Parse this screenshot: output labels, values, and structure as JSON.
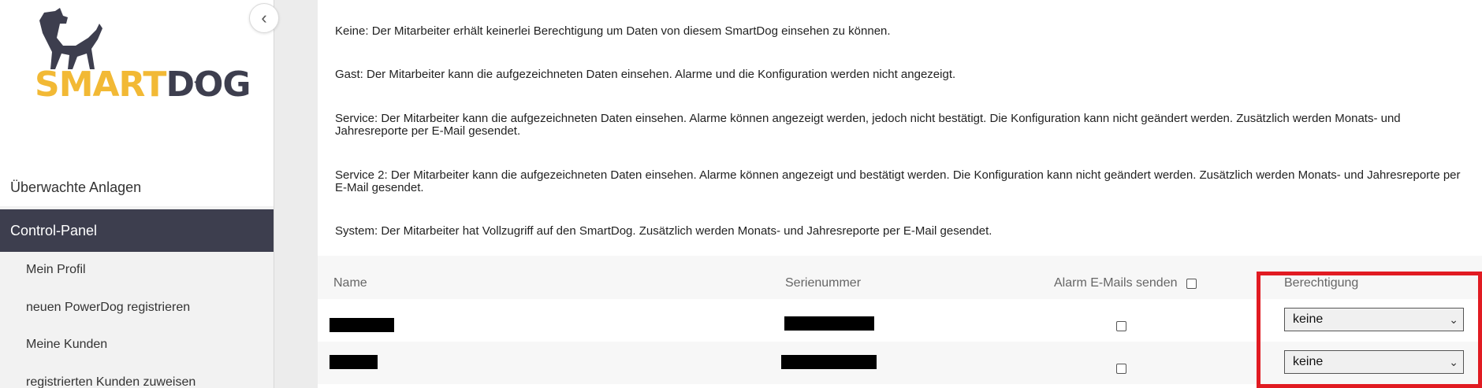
{
  "logo": {
    "part1": "SMART",
    "part2": "DOG"
  },
  "sidebar": {
    "collapse_icon": "chevron-left-icon",
    "items": [
      {
        "label": "Überwachte Anlagen"
      },
      {
        "label": "Control-Panel"
      }
    ],
    "subitems": [
      {
        "label": "Mein Profil"
      },
      {
        "label": "neuen PowerDog registrieren"
      },
      {
        "label": "Meine Kunden"
      },
      {
        "label": "registrierten Kunden zuweisen"
      }
    ]
  },
  "descriptions": [
    "Keine: Der Mitarbeiter erhält keinerlei Berechtigung um Daten von diesem SmartDog einsehen zu können.",
    "Gast: Der Mitarbeiter kann die aufgezeichneten Daten einsehen. Alarme und die Konfiguration werden nicht angezeigt.",
    "Service: Der Mitarbeiter kann die aufgezeichneten Daten einsehen. Alarme können angezeigt werden, jedoch nicht bestätigt. Die Konfiguration kann nicht geändert werden. Zusätzlich werden Monats- und Jahresreporte per E-Mail gesendet.",
    "Service 2: Der Mitarbeiter kann die aufgezeichneten Daten einsehen. Alarme können angezeigt und bestätigt werden. Die Konfiguration kann nicht geändert werden. Zusätzlich werden Monats- und Jahresreporte per E-Mail gesendet.",
    "System: Der Mitarbeiter hat Vollzugriff auf den SmartDog. Zusätzlich werden Monats- und Jahresreporte per E-Mail gesendet."
  ],
  "table": {
    "headers": {
      "name": "Name",
      "serial": "Serienummer",
      "alarm": "Alarm E-Mails senden",
      "permission": "Berechtigung"
    },
    "rows": [
      {
        "permission": "keine"
      },
      {
        "permission": "keine"
      }
    ]
  },
  "colors": {
    "brand_yellow": "#f2b935",
    "brand_dark": "#3d3e4e",
    "highlight_red": "#e11b22"
  }
}
